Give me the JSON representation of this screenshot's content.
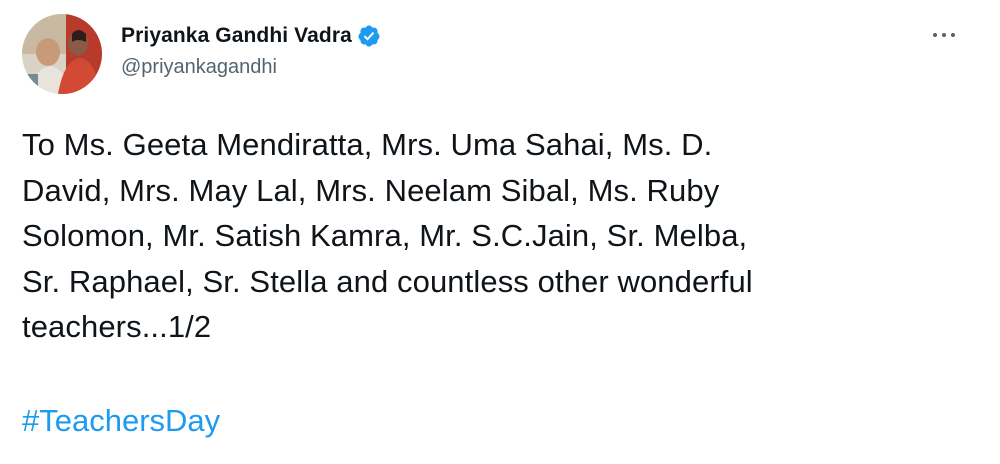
{
  "author": {
    "display_name": "Priyanka Gandhi Vadra",
    "handle": "@priyankagandhi",
    "verified": true
  },
  "tweet": {
    "text_lines": [
      "To Ms. Geeta Mendiratta, Mrs. Uma Sahai, Ms. D.",
      "David, Mrs. May Lal, Mrs. Neelam Sibal, Ms. Ruby",
      "Solomon, Mr. Satish Kamra, Mr. S.C.Jain, Sr. Melba,",
      "Sr. Raphael, Sr. Stella and countless other wonderful",
      "teachers...1/2"
    ],
    "hashtag": "#TeachersDay"
  },
  "icons": {
    "verified": "verified-badge-icon",
    "more": "more-options-icon"
  },
  "colors": {
    "link": "#1d9bf0",
    "secondary_text": "#536471",
    "primary_text": "#0f1419",
    "verified_badge": "#1d9bf0"
  }
}
